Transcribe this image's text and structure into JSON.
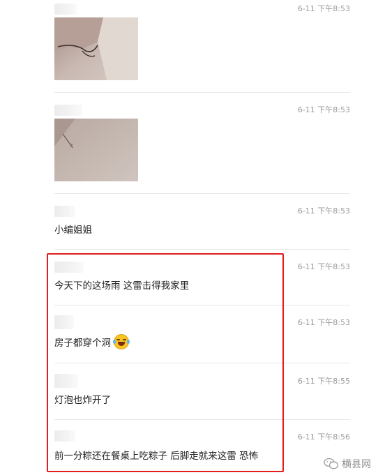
{
  "messages": [
    {
      "time": "6-11 下午8:53",
      "type": "image"
    },
    {
      "time": "6-11 下午8:53",
      "type": "image"
    },
    {
      "time": "6-11 下午8:53",
      "text": "小编姐姐"
    },
    {
      "time": "6-11 下午8:53",
      "text": "今天下的这场雨 这雷击得我家里"
    },
    {
      "time": "6-11 下午8:53",
      "text": "房子都穿个洞",
      "emoji": "laughing-crying-emoji"
    },
    {
      "time": "6-11 下午8:55",
      "text": "灯泡也炸开了"
    },
    {
      "time": "6-11 下午8:56",
      "text": "前一分粽还在餐桌上吃粽子 后脚走就来这雷 恐怖"
    }
  ],
  "watermark": {
    "text": "横县网",
    "icon": "wechat-logo-icon"
  },
  "colors": {
    "highlight": "#e31c1c",
    "time": "#9a9a9a",
    "divider": "#e8e8e8"
  }
}
